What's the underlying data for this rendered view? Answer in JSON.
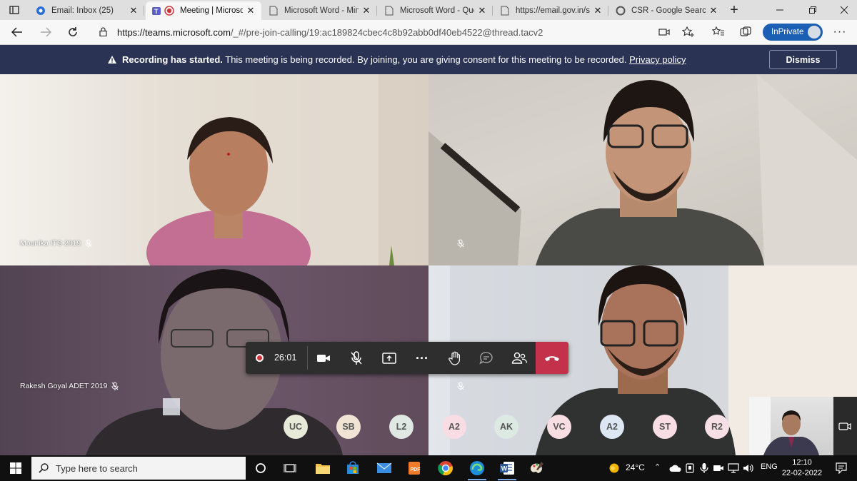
{
  "browser": {
    "tabs": [
      {
        "title": "Email: Inbox (25)",
        "icon": "email-favicon"
      },
      {
        "title": "Meeting | Microsof",
        "icon": "teams-recording-favicon",
        "active": true
      },
      {
        "title": "Microsoft Word - Min",
        "icon": "document-icon"
      },
      {
        "title": "Microsoft Word - Que",
        "icon": "document-icon"
      },
      {
        "title": "https://email.gov.in/sc",
        "icon": "document-icon"
      },
      {
        "title": "CSR - Google Search",
        "icon": "google-favicon"
      }
    ],
    "url_domain": "https://teams.microsoft.com",
    "url_path": "/_#/pre-join-calling/19:ac189824cbec4c8b92abb0df40eb4522@thread.tacv2",
    "inprivate_label": "InPrivate"
  },
  "banner": {
    "title": "Recording has started.",
    "message": " This meeting is being recorded. By joining, you are giving consent for this meeting to be recorded. ",
    "link": "Privacy policy",
    "dismiss": "Dismiss"
  },
  "tiles": [
    {
      "name": "Mounika ITS 2019"
    },
    {
      "name": ""
    },
    {
      "name": "Rakesh Goyal ADET 2019"
    },
    {
      "name": ""
    }
  ],
  "controls": {
    "timer": "26:01"
  },
  "participants": [
    "UC",
    "SB",
    "L2",
    "A2",
    "AK",
    "VC",
    "A2",
    "ST",
    "R2"
  ],
  "colors": {
    "banner_bg": "#2b3354",
    "hangup": "#c4314b",
    "recording": "#d13438",
    "inprivate": "#1a5fb4"
  },
  "taskbar": {
    "search_placeholder": "Type here to search",
    "temperature": "24°C",
    "language": "ENG",
    "time": "12:10",
    "date": "22-02-2022"
  }
}
